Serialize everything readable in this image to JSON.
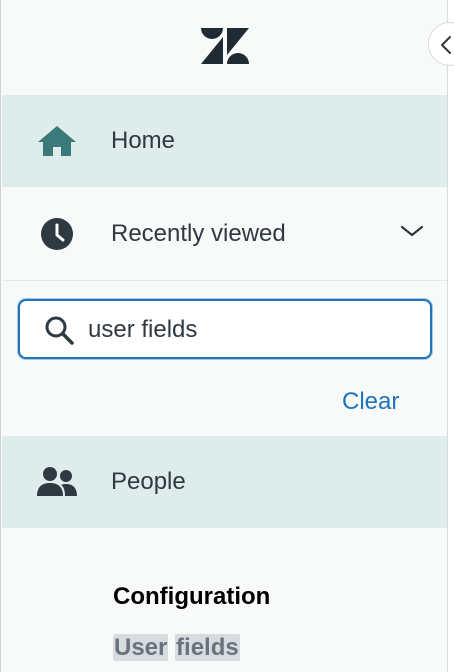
{
  "nav": {
    "home_label": "Home",
    "recent_label": "Recently viewed",
    "people_label": "People"
  },
  "search": {
    "value": "user fields",
    "clear_label": "Clear"
  },
  "results": {
    "section_title": "Configuration",
    "item_word_1": "User",
    "item_word_2": "fields"
  },
  "colors": {
    "active_bg": "#deedeb",
    "accent_blue": "#1f73b7",
    "icon_teal": "#3b7a7a",
    "text_dark": "#2f3941"
  },
  "icons": {
    "logo": "zendesk-logo",
    "home": "home-icon",
    "recent": "clock-icon",
    "chevron": "chevron-down-icon",
    "search": "search-icon",
    "people": "people-icon",
    "collapse": "chevron-left-icon"
  }
}
